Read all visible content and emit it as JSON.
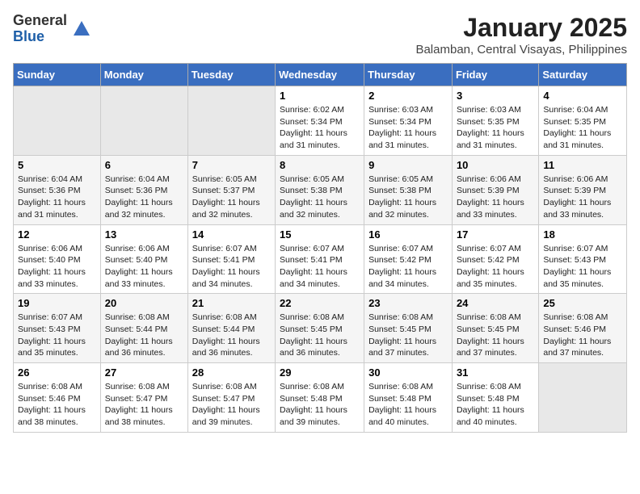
{
  "logo": {
    "general": "General",
    "blue": "Blue"
  },
  "title": "January 2025",
  "subtitle": "Balamban, Central Visayas, Philippines",
  "headers": [
    "Sunday",
    "Monday",
    "Tuesday",
    "Wednesday",
    "Thursday",
    "Friday",
    "Saturday"
  ],
  "weeks": [
    [
      {
        "day": "",
        "sunrise": "",
        "sunset": "",
        "daylight": "",
        "empty": true
      },
      {
        "day": "",
        "sunrise": "",
        "sunset": "",
        "daylight": "",
        "empty": true
      },
      {
        "day": "",
        "sunrise": "",
        "sunset": "",
        "daylight": "",
        "empty": true
      },
      {
        "day": "1",
        "sunrise": "Sunrise: 6:02 AM",
        "sunset": "Sunset: 5:34 PM",
        "daylight": "Daylight: 11 hours and 31 minutes."
      },
      {
        "day": "2",
        "sunrise": "Sunrise: 6:03 AM",
        "sunset": "Sunset: 5:34 PM",
        "daylight": "Daylight: 11 hours and 31 minutes."
      },
      {
        "day": "3",
        "sunrise": "Sunrise: 6:03 AM",
        "sunset": "Sunset: 5:35 PM",
        "daylight": "Daylight: 11 hours and 31 minutes."
      },
      {
        "day": "4",
        "sunrise": "Sunrise: 6:04 AM",
        "sunset": "Sunset: 5:35 PM",
        "daylight": "Daylight: 11 hours and 31 minutes."
      }
    ],
    [
      {
        "day": "5",
        "sunrise": "Sunrise: 6:04 AM",
        "sunset": "Sunset: 5:36 PM",
        "daylight": "Daylight: 11 hours and 31 minutes."
      },
      {
        "day": "6",
        "sunrise": "Sunrise: 6:04 AM",
        "sunset": "Sunset: 5:36 PM",
        "daylight": "Daylight: 11 hours and 32 minutes."
      },
      {
        "day": "7",
        "sunrise": "Sunrise: 6:05 AM",
        "sunset": "Sunset: 5:37 PM",
        "daylight": "Daylight: 11 hours and 32 minutes."
      },
      {
        "day": "8",
        "sunrise": "Sunrise: 6:05 AM",
        "sunset": "Sunset: 5:38 PM",
        "daylight": "Daylight: 11 hours and 32 minutes."
      },
      {
        "day": "9",
        "sunrise": "Sunrise: 6:05 AM",
        "sunset": "Sunset: 5:38 PM",
        "daylight": "Daylight: 11 hours and 32 minutes."
      },
      {
        "day": "10",
        "sunrise": "Sunrise: 6:06 AM",
        "sunset": "Sunset: 5:39 PM",
        "daylight": "Daylight: 11 hours and 33 minutes."
      },
      {
        "day": "11",
        "sunrise": "Sunrise: 6:06 AM",
        "sunset": "Sunset: 5:39 PM",
        "daylight": "Daylight: 11 hours and 33 minutes."
      }
    ],
    [
      {
        "day": "12",
        "sunrise": "Sunrise: 6:06 AM",
        "sunset": "Sunset: 5:40 PM",
        "daylight": "Daylight: 11 hours and 33 minutes."
      },
      {
        "day": "13",
        "sunrise": "Sunrise: 6:06 AM",
        "sunset": "Sunset: 5:40 PM",
        "daylight": "Daylight: 11 hours and 33 minutes."
      },
      {
        "day": "14",
        "sunrise": "Sunrise: 6:07 AM",
        "sunset": "Sunset: 5:41 PM",
        "daylight": "Daylight: 11 hours and 34 minutes."
      },
      {
        "day": "15",
        "sunrise": "Sunrise: 6:07 AM",
        "sunset": "Sunset: 5:41 PM",
        "daylight": "Daylight: 11 hours and 34 minutes."
      },
      {
        "day": "16",
        "sunrise": "Sunrise: 6:07 AM",
        "sunset": "Sunset: 5:42 PM",
        "daylight": "Daylight: 11 hours and 34 minutes."
      },
      {
        "day": "17",
        "sunrise": "Sunrise: 6:07 AM",
        "sunset": "Sunset: 5:42 PM",
        "daylight": "Daylight: 11 hours and 35 minutes."
      },
      {
        "day": "18",
        "sunrise": "Sunrise: 6:07 AM",
        "sunset": "Sunset: 5:43 PM",
        "daylight": "Daylight: 11 hours and 35 minutes."
      }
    ],
    [
      {
        "day": "19",
        "sunrise": "Sunrise: 6:07 AM",
        "sunset": "Sunset: 5:43 PM",
        "daylight": "Daylight: 11 hours and 35 minutes."
      },
      {
        "day": "20",
        "sunrise": "Sunrise: 6:08 AM",
        "sunset": "Sunset: 5:44 PM",
        "daylight": "Daylight: 11 hours and 36 minutes."
      },
      {
        "day": "21",
        "sunrise": "Sunrise: 6:08 AM",
        "sunset": "Sunset: 5:44 PM",
        "daylight": "Daylight: 11 hours and 36 minutes."
      },
      {
        "day": "22",
        "sunrise": "Sunrise: 6:08 AM",
        "sunset": "Sunset: 5:45 PM",
        "daylight": "Daylight: 11 hours and 36 minutes."
      },
      {
        "day": "23",
        "sunrise": "Sunrise: 6:08 AM",
        "sunset": "Sunset: 5:45 PM",
        "daylight": "Daylight: 11 hours and 37 minutes."
      },
      {
        "day": "24",
        "sunrise": "Sunrise: 6:08 AM",
        "sunset": "Sunset: 5:45 PM",
        "daylight": "Daylight: 11 hours and 37 minutes."
      },
      {
        "day": "25",
        "sunrise": "Sunrise: 6:08 AM",
        "sunset": "Sunset: 5:46 PM",
        "daylight": "Daylight: 11 hours and 37 minutes."
      }
    ],
    [
      {
        "day": "26",
        "sunrise": "Sunrise: 6:08 AM",
        "sunset": "Sunset: 5:46 PM",
        "daylight": "Daylight: 11 hours and 38 minutes."
      },
      {
        "day": "27",
        "sunrise": "Sunrise: 6:08 AM",
        "sunset": "Sunset: 5:47 PM",
        "daylight": "Daylight: 11 hours and 38 minutes."
      },
      {
        "day": "28",
        "sunrise": "Sunrise: 6:08 AM",
        "sunset": "Sunset: 5:47 PM",
        "daylight": "Daylight: 11 hours and 39 minutes."
      },
      {
        "day": "29",
        "sunrise": "Sunrise: 6:08 AM",
        "sunset": "Sunset: 5:48 PM",
        "daylight": "Daylight: 11 hours and 39 minutes."
      },
      {
        "day": "30",
        "sunrise": "Sunrise: 6:08 AM",
        "sunset": "Sunset: 5:48 PM",
        "daylight": "Daylight: 11 hours and 40 minutes."
      },
      {
        "day": "31",
        "sunrise": "Sunrise: 6:08 AM",
        "sunset": "Sunset: 5:48 PM",
        "daylight": "Daylight: 11 hours and 40 minutes."
      },
      {
        "day": "",
        "sunrise": "",
        "sunset": "",
        "daylight": "",
        "empty": true
      }
    ]
  ]
}
